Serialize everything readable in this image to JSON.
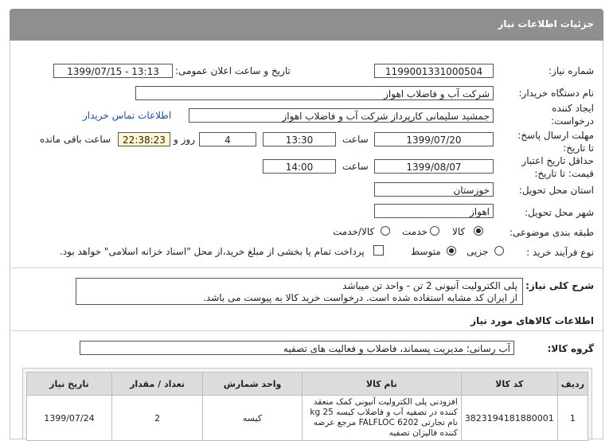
{
  "panel": {
    "title": "جزئیات اطلاعات نیاز"
  },
  "fields": {
    "need_number_label": "شماره نیاز:",
    "need_number": "1199001331000504",
    "announce_label": "تاریخ و ساعت اعلان عمومی:",
    "announce_value": "1399/07/15 - 13:13",
    "buyer_org_label": "نام دستگاه خریدار:",
    "buyer_org": "شرکت آب و فاضلاب اهواز",
    "requester_label_1": "ایجاد کننده",
    "requester_label_2": "درخواست:",
    "requester": "جمشید سلیمانی کارپرداز شرکت آب و فاضلاب اهواز",
    "contact_link": "اطلاعات تماس خریدار",
    "deadline_label_1": "مهلت ارسال پاسخ:",
    "deadline_label_2": "تا تاریخ:",
    "deadline_date": "1399/07/20",
    "time_label": "ساعت",
    "deadline_time": "13:30",
    "days_value": "4",
    "days_label": "روز و",
    "remaining_time": "22:38:23",
    "remaining_label": "ساعت باقی مانده",
    "validity_label_1": "حداقل تاریخ اعتبار",
    "validity_label_2": "قیمت: تا تاریخ:",
    "validity_date": "1399/08/07",
    "validity_time": "14:00",
    "province_label": "استان محل تحویل:",
    "province": "خوزستان",
    "city_label": "شهر محل تحویل:",
    "city": "اهواز",
    "category_label": "طبقه بندی موضوعی:",
    "category_options": [
      "کالا",
      "خدمت",
      "کالا/خدمت"
    ],
    "category_selected": 0,
    "process_label": "نوع فرآیند خرید :",
    "process_options": [
      "جزیی",
      "متوسط"
    ],
    "process_selected": 1,
    "payment_note": "پرداخت تمام یا بخشی از مبلغ خرید،از محل \"اسناد خزانه اسلامی\" خواهد بود."
  },
  "description": {
    "label": "شرح کلی نیاز:",
    "line1": "پلی الکترولیت آنیونی 2 تن - واحد تن میباشد",
    "line2": "از ایران کد مشابه استفاده شده است. درخواست خرید کالا به پیوست می باشد."
  },
  "goods": {
    "section_title": "اطلاعات کالاهای مورد نیاز",
    "group_label": "گروه کالا:",
    "group_value": "آب رسانی؛ مدیریت پسماند، فاضلاب و فعالیت های تصفیه",
    "columns": [
      "ردیف",
      "کد کالا",
      "نام کالا",
      "واحد شمارش",
      "تعداد / مقدار",
      "تاریخ نیاز"
    ],
    "rows": [
      {
        "index": "1",
        "code": "3823194181880001",
        "name": "افزودنی پلی الکترولیت آنیونی کمک منعقد کننده در تصفیه آب و فاضلاب کیسه 25 kg نام تجارتی FALFLOC 6202 مرجع عرضه کننده فالیزان تصفیه",
        "unit": "کیسه",
        "qty": "2",
        "date": "1399/07/24"
      }
    ]
  },
  "colors": {
    "header_bg": "#8f8f8f",
    "link": "#1a4fa8",
    "remaining_bg": "#fff6cf",
    "table_header_bg": "#dcdcdc"
  }
}
